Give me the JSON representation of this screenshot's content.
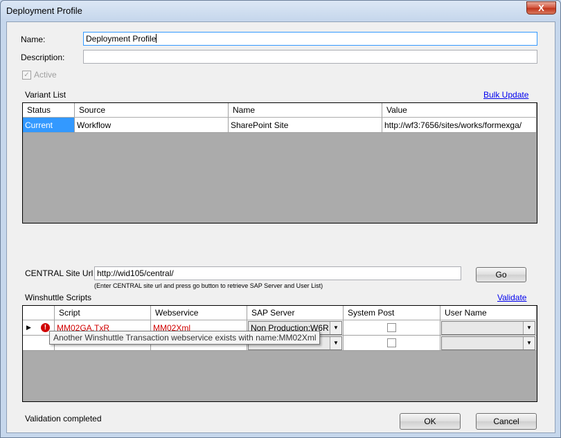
{
  "window": {
    "title": "Deployment Profile",
    "close_label": "X"
  },
  "form": {
    "name_label": "Name:",
    "name_value": "Deployment Profile",
    "description_label": "Description:",
    "description_value": "",
    "active_label": "Active",
    "active_checked": true
  },
  "variant_list": {
    "section_label": "Variant List",
    "bulk_update_label": "Bulk Update",
    "columns": [
      "Status",
      "Source",
      "Name",
      "Value"
    ],
    "rows": [
      {
        "status": "Current",
        "source": "Workflow",
        "name": "SharePoint Site",
        "value": "http://wf3:7656/sites/works/formexga/"
      }
    ]
  },
  "central": {
    "label": "CENTRAL Site Url :",
    "value": "http://wid105/central/",
    "hint": "(Enter CENTRAL site url and press go button to retrieve SAP Server and User List)",
    "go_label": "Go"
  },
  "scripts": {
    "section_label": "Winshuttle Scripts",
    "validate_label": "Validate",
    "columns": [
      "Script",
      "Webservice",
      "SAP Server",
      "System Post",
      "User Name"
    ],
    "rows": [
      {
        "indicator": "▶",
        "error": "!",
        "script": "MM02GA.TxR",
        "webservice": "MM02Xml",
        "sap_server": "Non Production:W6R...",
        "system_post": false,
        "user_name": ""
      },
      {
        "indicator": "",
        "error": "",
        "script": "",
        "webservice": "",
        "sap_server": "",
        "system_post": false,
        "user_name": ""
      }
    ],
    "tooltip": "Another Winshuttle Transaction webservice exists with name:MM02Xml"
  },
  "footer": {
    "status": "Validation completed",
    "ok_label": "OK",
    "cancel_label": "Cancel"
  }
}
